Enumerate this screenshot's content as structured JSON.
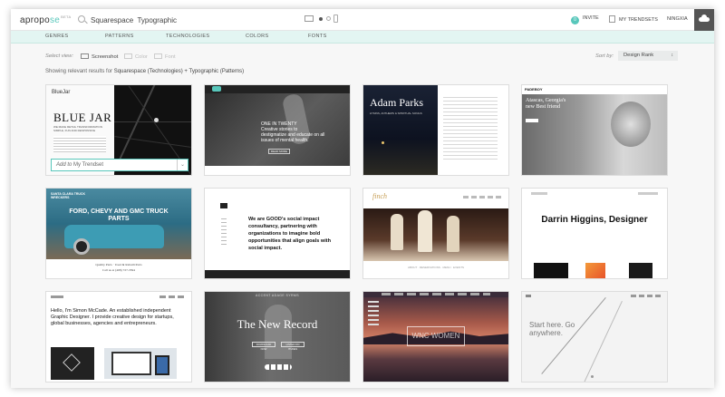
{
  "logo": {
    "text_a": "apropo",
    "text_b": "se",
    "beta": "BETA"
  },
  "search": {
    "value": "Squarespace  Typographic"
  },
  "header": {
    "invite_count": "0",
    "invite": "INVITE",
    "my_trendsets": "MY TRENDSETS",
    "user": "NINGXIA"
  },
  "nav": {
    "items": [
      "GENRES",
      "PATTERNS",
      "TECHNOLOGIES",
      "COLORS",
      "FONTS"
    ]
  },
  "view": {
    "label": "Select view:",
    "options": [
      "Screenshot",
      "Color",
      "Font"
    ]
  },
  "sort": {
    "label": "Sort by:",
    "value": "Design Rank"
  },
  "results": {
    "prefix": "Showing relevant results for ",
    "query": "Squarespace (Technologies) + Typographic (Patterns)"
  },
  "add_trendset": {
    "prefix": "Add to",
    "target": "My Trendset"
  },
  "cards": [
    {
      "title": "BLUE JAR",
      "brand": "BlueJar",
      "lines": [
        "WE MAKE RETAIL TRANSFORMATION",
        "SIMPLE, FUN AND RESPONSIVE"
      ]
    },
    {
      "title": "ONE IN TWENTY",
      "lines": [
        "Creative stories to",
        "destigmatize and educate on all",
        "issues of mental health."
      ],
      "button": "READ MORE"
    },
    {
      "title": "Adam Parks",
      "subtitle": "HYMNS, ANTHEMS & SPIRITUAL SONGS"
    },
    {
      "brand": "PADEBOY",
      "title": "Atascas, Georgia's new Best friend"
    },
    {
      "brand": "SANTA CLARA TRUCK WRECKERS",
      "title": "FORD, CHEVY AND GMC TRUCK PARTS",
      "footer": "Quality Parts · Used & Rebuilt Parts",
      "footer2": "Call us at (408) 727-3594"
    },
    {
      "title": "We are GOOD's social impact consultancy, partnering with organizations to imagine bold opportunities that align goals with social impact."
    },
    {
      "brand": "finch",
      "footer": "ABOUT · RESERVATIONS · MENU · EVENTS"
    },
    {
      "title": "Darrin Higgins, Designer"
    },
    {
      "title": "Hello, I'm Simon McCade. An established independent Graphic Designer. I provide creative design for startups, global businesses, agencies and entrepreneurs."
    },
    {
      "brand": "ACCENT ADAGE SYRMS",
      "title": "The New Record",
      "btn1": "DOWNLOAD NOW",
      "btn2": "LISTEN ON ITUNES"
    },
    {
      "title": "WNC WOMEN"
    },
    {
      "title": "Start here. Go anywhere."
    }
  ],
  "colors": {
    "accent": "#58c7bb",
    "nav_bg": "#e3f5f2",
    "dark_btn": "#555555"
  }
}
